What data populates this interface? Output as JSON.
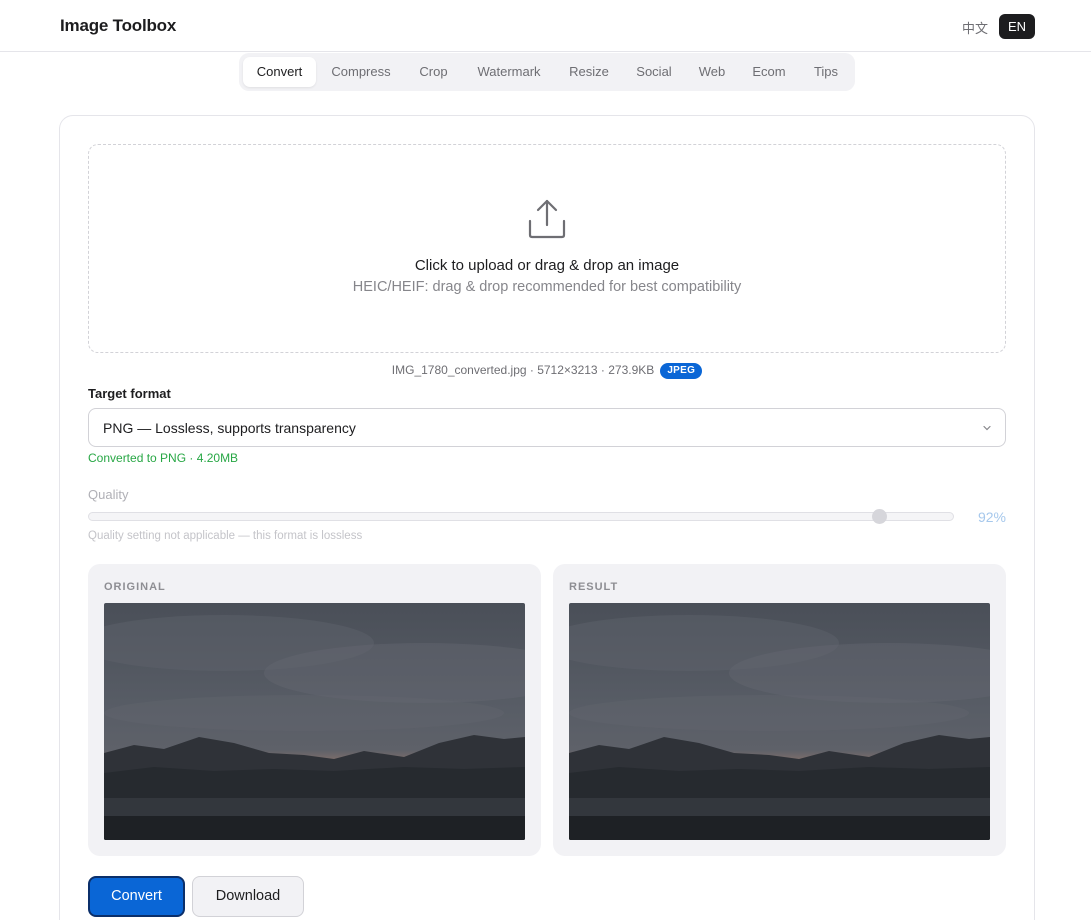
{
  "app": {
    "title": "Image Toolbox"
  },
  "language": {
    "zh": "中文",
    "en": "EN",
    "selected": "EN"
  },
  "tabs": [
    {
      "label": "Convert",
      "active": true
    },
    {
      "label": "Compress",
      "active": false
    },
    {
      "label": "Crop",
      "active": false
    },
    {
      "label": "Watermark",
      "active": false
    },
    {
      "label": "Resize",
      "active": false
    },
    {
      "label": "Social",
      "active": false
    },
    {
      "label": "Web",
      "active": false
    },
    {
      "label": "Ecom",
      "active": false
    },
    {
      "label": "Tips",
      "active": false
    }
  ],
  "upload": {
    "icon": "upload-icon",
    "title": "Click to upload or drag & drop an image",
    "hint": "HEIC/HEIF: drag & drop recommended for best compatibility"
  },
  "file": {
    "info": "IMG_1780_converted.jpg · 5712×3213 · 273.9KB",
    "format_badge": "JPEG"
  },
  "target": {
    "label": "Target format",
    "value": "PNG — Lossless, supports transparency",
    "status": "Converted to PNG · 4.20MB"
  },
  "quality": {
    "label": "Quality",
    "value": 92,
    "display": "92%",
    "note": "Quality setting not applicable — this format is lossless"
  },
  "preview": {
    "original_label": "ORIGINAL",
    "result_label": "RESULT"
  },
  "actions": {
    "convert_label": "Convert",
    "download_label": "Download"
  },
  "colors": {
    "accent": "#0a66d6",
    "success": "#28a745",
    "panel_bg": "#f2f2f5"
  }
}
